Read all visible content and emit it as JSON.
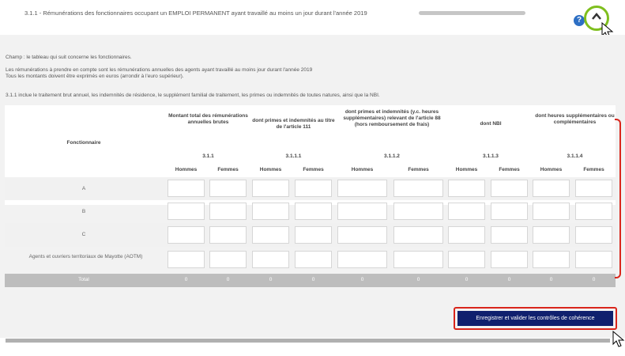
{
  "header": {
    "title": "3.1.1 - Rémunérations des fonctionnaires occupant un EMPLOI PERMANENT ayant travaillé au moins un jour durant l'année 2019",
    "help_icon": "question-circle-icon",
    "collapse_icon": "chevron-up-icon"
  },
  "panel": {
    "scope": "Champ : le tableau qui suit concerne les fonctionnaires.",
    "info1": "Les rémunérations à prendre en compte sont les rémunérations annuelles des agents ayant travaillé au moins jour durant l'année 2019",
    "info2": "Tous les montants doivent être exprimés en euros (arrondir à l'euro supérieur).",
    "info3": "3.1.1 inclue le traitement brut annuel, les indemnités de résidence, le supplément familial de traitement, les primes ou indemnités de toutes natures, ainsi que la NBI."
  },
  "table": {
    "row_header": "Fonctionnaire",
    "columns": [
      {
        "label": "Montant total des rémunérations annuelles brutes",
        "code": "3.1.1"
      },
      {
        "label": "dont primes et indemnités au titre de l'article 111",
        "code": "3.1.1.1"
      },
      {
        "label": "dont primes et indemnités (y.c. heures supplémentaires) relevant de l'article 88 (hors remboursement de frais)",
        "code": "3.1.1.2"
      },
      {
        "label": "dont NBI",
        "code": "3.1.1.3"
      },
      {
        "label": "dont heures supplémentaires ou complémentaires",
        "code": "3.1.1.4"
      }
    ],
    "sub_hommes": "Hommes",
    "sub_femmes": "Femmes",
    "rows": [
      "A",
      "B",
      "C",
      "Agents et ouvriers territoriaux de Mayotte (AOTM)"
    ],
    "total_label": "Total",
    "totals": [
      "0",
      "0",
      "0",
      "0",
      "0",
      "0",
      "0",
      "0",
      "0",
      "0"
    ]
  },
  "save_button": "Enregistrer et valider les contrôles de cohérence",
  "colors": {
    "accent_green": "#7fbf1e",
    "highlight_red": "#d9261c",
    "button_navy": "#10206e"
  }
}
